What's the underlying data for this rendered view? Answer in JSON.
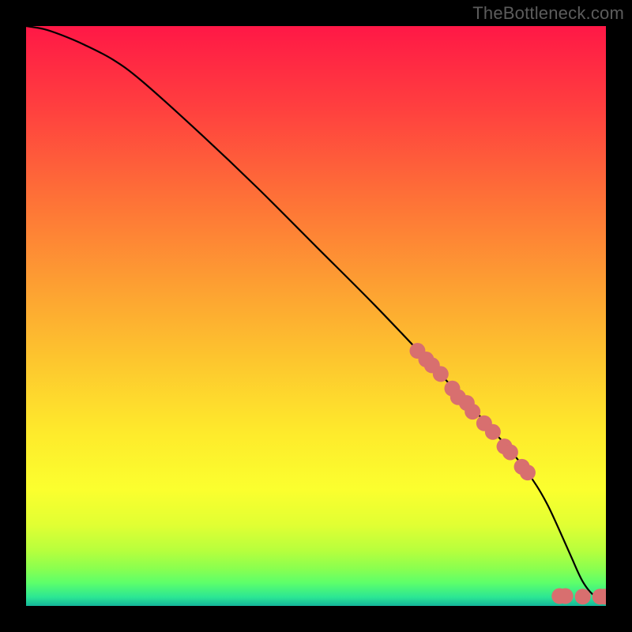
{
  "watermark": "TheBottleneck.com",
  "chart_data": {
    "type": "line",
    "title": "",
    "xlabel": "",
    "ylabel": "",
    "xlim": [
      0,
      100
    ],
    "ylim": [
      0,
      100
    ],
    "grid": false,
    "legend": false,
    "curve": {
      "x": [
        0,
        3,
        6,
        10,
        15,
        20,
        30,
        40,
        50,
        60,
        70,
        75,
        80,
        85,
        88,
        90,
        92,
        94,
        96,
        98,
        100
      ],
      "y": [
        100,
        99.5,
        98.5,
        96.8,
        94.2,
        90.5,
        81.5,
        72.0,
        62.0,
        52.0,
        41.5,
        36.2,
        30.8,
        25.0,
        20.8,
        17.3,
        13.0,
        8.5,
        4.2,
        1.8,
        1.5
      ]
    },
    "markers": {
      "x": [
        67.5,
        69.0,
        70.0,
        71.5,
        73.5,
        74.5,
        76.0,
        77.0,
        79.0,
        80.5,
        82.5,
        83.5,
        85.5,
        86.5,
        92.0,
        93.0,
        96.0,
        99.0,
        99.8
      ],
      "y": [
        44.0,
        42.5,
        41.5,
        40.0,
        37.5,
        36.0,
        35.0,
        33.5,
        31.5,
        30.0,
        27.5,
        26.5,
        24.0,
        23.0,
        1.7,
        1.7,
        1.6,
        1.6,
        1.6
      ],
      "color": "#d86f6f",
      "radius": 10
    },
    "gradient_stops": [
      {
        "offset": 0.0,
        "color": "#ff1846"
      },
      {
        "offset": 0.14,
        "color": "#ff3f3f"
      },
      {
        "offset": 0.3,
        "color": "#fe7237"
      },
      {
        "offset": 0.45,
        "color": "#fda032"
      },
      {
        "offset": 0.58,
        "color": "#fdc72e"
      },
      {
        "offset": 0.7,
        "color": "#feea2c"
      },
      {
        "offset": 0.8,
        "color": "#fbff2e"
      },
      {
        "offset": 0.86,
        "color": "#e1ff33"
      },
      {
        "offset": 0.905,
        "color": "#b7ff3d"
      },
      {
        "offset": 0.935,
        "color": "#8bff4f"
      },
      {
        "offset": 0.96,
        "color": "#5dff6a"
      },
      {
        "offset": 0.985,
        "color": "#2be694"
      },
      {
        "offset": 1.0,
        "color": "#14b69a"
      }
    ]
  }
}
